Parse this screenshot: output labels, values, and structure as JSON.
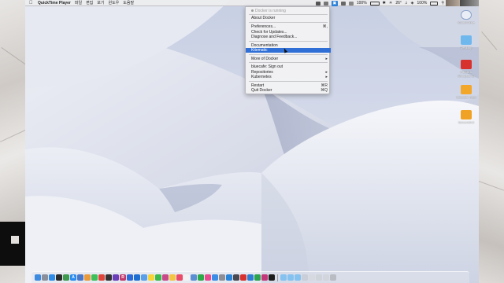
{
  "menubar": {
    "app_name": "QuickTime Player",
    "menus": [
      "파일",
      "편집",
      "보기",
      "윈도우",
      "도움말"
    ],
    "battery": "100%",
    "temperature": "26°",
    "battery_right": "100%"
  },
  "docker_menu": {
    "status": "Docker is running",
    "items": [
      {
        "label": "About Docker",
        "shortcut": ""
      },
      {
        "label": "Preferences...",
        "shortcut": "⌘,"
      },
      {
        "label": "Check for Updates...",
        "shortcut": ""
      },
      {
        "label": "Diagnose and Feedback...",
        "shortcut": ""
      },
      {
        "label": "Documentation",
        "shortcut": ""
      },
      {
        "label": "Kitematic",
        "shortcut": ""
      },
      {
        "label": "More of Docker",
        "shortcut": "▸"
      },
      {
        "label": "bluecafe: Sign out",
        "shortcut": ""
      },
      {
        "label": "Repositories",
        "shortcut": "▸"
      },
      {
        "label": "Kubernetes",
        "shortcut": "▸"
      },
      {
        "label": "Restart",
        "shortcut": "⌘R"
      },
      {
        "label": "Quit Docker",
        "shortcut": "⌘Q"
      }
    ],
    "highlighted": "Kitematic"
  },
  "desktop_icons": [
    {
      "label": "iCloud Drive",
      "icon": "cloud-icon",
      "color": "#e9eef6"
    },
    {
      "label": "Desktop",
      "icon": "folder-icon",
      "color": "#6fb8ee"
    },
    {
      "label": "Parallels Windows 10",
      "icon": "parallels-icon",
      "color": "#d8322f"
    },
    {
      "label": "Bluecafe SSD",
      "icon": "drive-icon",
      "color": "#f2a62a"
    },
    {
      "label": "Screenshot",
      "icon": "drive-icon",
      "color": "#f0a225"
    }
  ],
  "dock": {
    "apps": [
      {
        "icon": "finder-icon",
        "color": "#3d8be0",
        "glyph": ""
      },
      {
        "icon": "launchpad-icon",
        "color": "#8a8f9a",
        "glyph": ""
      },
      {
        "icon": "safari-icon",
        "color": "#2f8de8",
        "glyph": ""
      },
      {
        "icon": "terminal-icon",
        "color": "#2b2b2b",
        "glyph": ""
      },
      {
        "icon": "activity-icon",
        "color": "#3e9a4c",
        "glyph": ""
      },
      {
        "icon": "appstore-icon",
        "color": "#2a8cf0",
        "glyph": "A"
      },
      {
        "icon": "finder2-icon",
        "color": "#4a78c8",
        "glyph": ""
      },
      {
        "icon": "photos-icon",
        "color": "#e89a3c",
        "glyph": ""
      },
      {
        "icon": "messages-icon",
        "color": "#3fbf5a",
        "glyph": ""
      },
      {
        "icon": "chrome-icon",
        "color": "#e0463a",
        "glyph": ""
      },
      {
        "icon": "unity-icon",
        "color": "#333333",
        "glyph": ""
      },
      {
        "icon": "vs-icon",
        "color": "#6a3fb8",
        "glyph": ""
      },
      {
        "icon": "rider-icon",
        "color": "#c13a6a",
        "glyph": "R"
      },
      {
        "icon": "sourcetree-icon",
        "color": "#2b6cd8",
        "glyph": ""
      },
      {
        "icon": "xcode-icon",
        "color": "#1e6fd0",
        "glyph": ""
      },
      {
        "icon": "mail-icon",
        "color": "#5aa0e8",
        "glyph": ""
      },
      {
        "icon": "kakaotalk-icon",
        "color": "#f7d439",
        "glyph": ""
      },
      {
        "icon": "line-icon",
        "color": "#3cba4e",
        "glyph": ""
      },
      {
        "icon": "slack-icon",
        "color": "#c84a8a",
        "glyph": ""
      },
      {
        "icon": "notes-icon",
        "color": "#f4c542",
        "glyph": ""
      },
      {
        "icon": "music-icon",
        "color": "#ea4c6a",
        "glyph": ""
      },
      {
        "icon": "calendar-icon",
        "color": "#f2f2f2",
        "glyph": ""
      },
      {
        "icon": "preview-icon",
        "color": "#5b8fd4",
        "glyph": ""
      },
      {
        "icon": "numbers-icon",
        "color": "#2faa48",
        "glyph": ""
      },
      {
        "icon": "itunes-icon",
        "color": "#e94b8f",
        "glyph": ""
      },
      {
        "icon": "appstore2-icon",
        "color": "#3c8de6",
        "glyph": ""
      },
      {
        "icon": "settings-icon",
        "color": "#8c8f96",
        "glyph": ""
      },
      {
        "icon": "docker-icon",
        "color": "#2a86d8",
        "glyph": ""
      },
      {
        "icon": "quicktime-icon",
        "color": "#4a4a52",
        "glyph": ""
      },
      {
        "icon": "parallels-icon",
        "color": "#d8322f",
        "glyph": ""
      },
      {
        "icon": "vscode-icon",
        "color": "#2c7fd2",
        "glyph": ""
      },
      {
        "icon": "pycharm-icon",
        "color": "#2ba34f",
        "glyph": ""
      },
      {
        "icon": "intellij-icon",
        "color": "#c4367a",
        "glyph": ""
      },
      {
        "icon": "terminal2-icon",
        "color": "#1c1c1c",
        "glyph": ""
      }
    ],
    "files": [
      {
        "icon": "folder-icon",
        "color": "#86c2f0"
      },
      {
        "icon": "folder-icon",
        "color": "#86c2f0"
      },
      {
        "icon": "folder-icon",
        "color": "#86c2f0"
      },
      {
        "icon": "image-icon",
        "color": "#c9ced8"
      },
      {
        "icon": "image-icon",
        "color": "#d6d9df"
      },
      {
        "icon": "image-icon",
        "color": "#cfd3da"
      },
      {
        "icon": "image-icon",
        "color": "#d2d5db"
      },
      {
        "icon": "trash-icon",
        "color": "#b9bcc2"
      }
    ]
  }
}
